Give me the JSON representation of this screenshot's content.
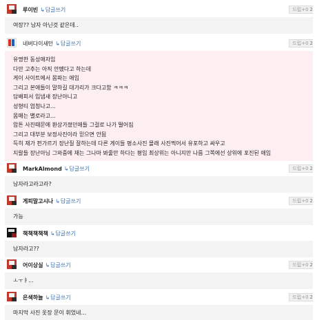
{
  "controls": {
    "label": "드립+0",
    "count": "2"
  },
  "reply_label": "답글쓰기",
  "comments": [
    {
      "user": "루이빈",
      "lines": [
        "여장?? 남자 아닌것 같은데.."
      ]
    },
    {
      "user": "네버다이새턴",
      "lines": [
        "유명한 동성애자임",
        "다만 고추는 아직 안뗐다고 하는데",
        "게이 사이트에서 몸파는 애임",
        "그리고 본애들이 말하길 대가리가 크다고함 ㅋㅋㅋ",
        "담배피서 입냄새 장난아니고",
        "성형티 엄청나고...",
        "몸매는 별로라고...",
        "암튼 사진때문에 환상가졌던애들 그걸로 나가 떨어짐",
        "그리고 대부분 보정사진이라 믿으면 안됨",
        "득히 재가 펀가르기 장난질 잘하는데 다른 게이들 평소사진 몰래 사진찍어서 유포하고 싸우고",
        "지랄들 장난아님 그와중에 재는 그나마 봐줄만 하다는 평임 최상위는 아니지만 나름 그쪽에선 상위에 포진된 애임"
      ]
    },
    {
      "user": "MarkAlmond",
      "lines": [
        "남자라고라고라?"
      ]
    },
    {
      "user": "게피말고시나",
      "lines": [
        "가능"
      ]
    },
    {
      "user": "책책책책책",
      "lines": [
        "남자라고??"
      ]
    },
    {
      "user": "어이상실",
      "lines": [
        "ㅗㅜㅑ..."
      ]
    },
    {
      "user": "은색하늘",
      "lines": [
        "마지막 사진 옷장 문이 휘었네..."
      ]
    }
  ],
  "icons": {
    "reply_arrow": "reply-arrow-icon"
  }
}
